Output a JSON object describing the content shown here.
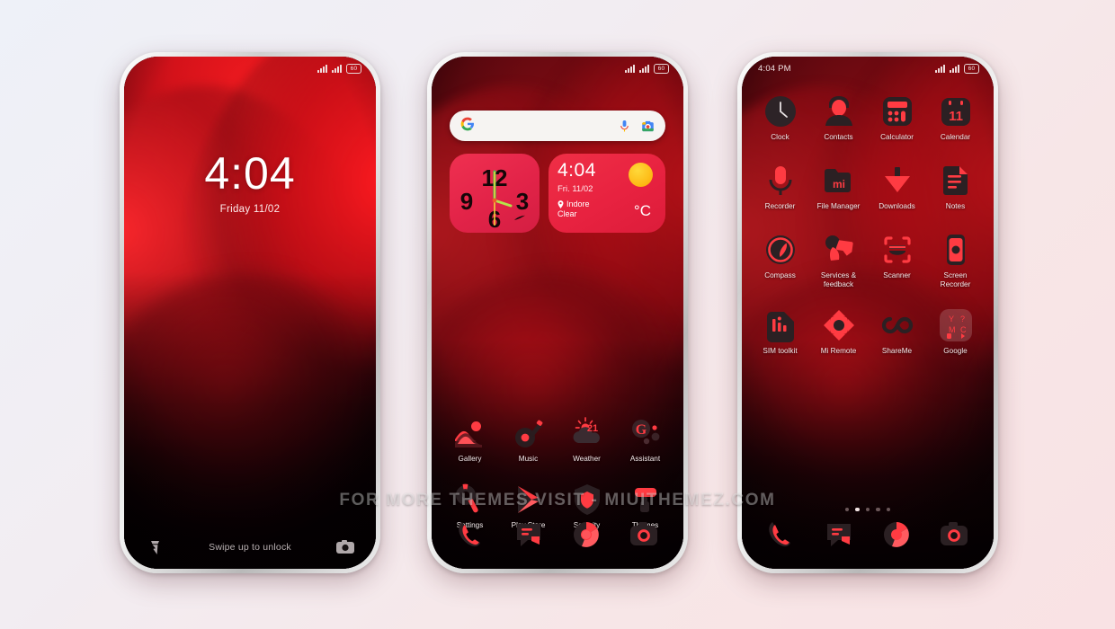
{
  "watermark": "FOR MORE THEMES VISIT - MIUITHEMEZ.COM",
  "theme": {
    "accent": "#ee2a3e",
    "accent_light": "#ff4a56",
    "icon_base": "#1a1113",
    "widget_pink": "#ee2a48",
    "sun_yellow": "#fdb813",
    "label_color": "#f3e9ea",
    "bg_start": "#eef1f8",
    "bg_end": "#f8e2e4"
  },
  "phones": [
    {
      "id": "lockscreen",
      "status": {
        "time": "",
        "signal1": "signal-icon",
        "signal2": "signal-icon",
        "battery": "60"
      },
      "lock": {
        "time": "4:04",
        "date": "Friday 11/02",
        "hint": "Swipe up to unlock",
        "left_icon": "flashlight-icon",
        "right_icon": "camera-icon"
      }
    },
    {
      "id": "homescreen",
      "status": {
        "time": "",
        "battery": "60"
      },
      "search": {
        "placeholder": "",
        "google_icon": "google-g-icon",
        "mic_icon": "microphone-icon",
        "lens_icon": "google-lens-icon"
      },
      "widgets": {
        "clock": {
          "name": "analog-clock-widget",
          "marks": [
            "12",
            "3",
            "6",
            "9"
          ],
          "brand": "nike-swoosh"
        },
        "weather": {
          "time": "4:04",
          "date": "Fri. 11/02",
          "location": "Indore",
          "condition": "Clear",
          "unit": "°C",
          "icon": "sun-icon"
        }
      },
      "apps": [
        {
          "label": "Gallery",
          "icon": "gallery-icon"
        },
        {
          "label": "Music",
          "icon": "music-icon"
        },
        {
          "label": "Weather",
          "icon": "weather-icon",
          "temp": "21"
        },
        {
          "label": "Assistant",
          "icon": "google-assistant-icon"
        },
        {
          "label": "Settings",
          "icon": "settings-icon"
        },
        {
          "label": "Play Store",
          "icon": "play-store-icon"
        },
        {
          "label": "Security",
          "icon": "security-icon"
        },
        {
          "label": "Themes",
          "icon": "themes-icon"
        }
      ],
      "dock": [
        {
          "label": "Phone",
          "icon": "phone-icon"
        },
        {
          "label": "Messages",
          "icon": "messages-icon"
        },
        {
          "label": "Browser",
          "icon": "browser-icon"
        },
        {
          "label": "Camera",
          "icon": "camera-icon"
        }
      ]
    },
    {
      "id": "app-drawer",
      "status": {
        "time": "4:04 PM",
        "battery": "60"
      },
      "apps": [
        {
          "label": "Clock",
          "icon": "clock-icon"
        },
        {
          "label": "Contacts",
          "icon": "contacts-icon"
        },
        {
          "label": "Calculator",
          "icon": "calculator-icon"
        },
        {
          "label": "Calendar",
          "icon": "calendar-icon",
          "day": "11"
        },
        {
          "label": "Recorder",
          "icon": "recorder-icon"
        },
        {
          "label": "File Manager",
          "icon": "file-manager-icon"
        },
        {
          "label": "Downloads",
          "icon": "downloads-icon"
        },
        {
          "label": "Notes",
          "icon": "notes-icon"
        },
        {
          "label": "Compass",
          "icon": "compass-icon"
        },
        {
          "label": "Services & feedback",
          "icon": "services-feedback-icon"
        },
        {
          "label": "Scanner",
          "icon": "scanner-icon"
        },
        {
          "label": "Screen Recorder",
          "icon": "screen-recorder-icon"
        },
        {
          "label": "SIM toolkit",
          "icon": "sim-toolkit-icon"
        },
        {
          "label": "Mi Remote",
          "icon": "mi-remote-icon"
        },
        {
          "label": "ShareMe",
          "icon": "shareme-icon"
        },
        {
          "label": "Google",
          "icon": "google-folder-icon"
        }
      ],
      "pages": {
        "count": 5,
        "active": 1
      },
      "dock": [
        {
          "label": "Phone",
          "icon": "phone-icon"
        },
        {
          "label": "Messages",
          "icon": "messages-icon"
        },
        {
          "label": "Browser",
          "icon": "browser-icon"
        },
        {
          "label": "Camera",
          "icon": "camera-icon"
        }
      ]
    }
  ]
}
